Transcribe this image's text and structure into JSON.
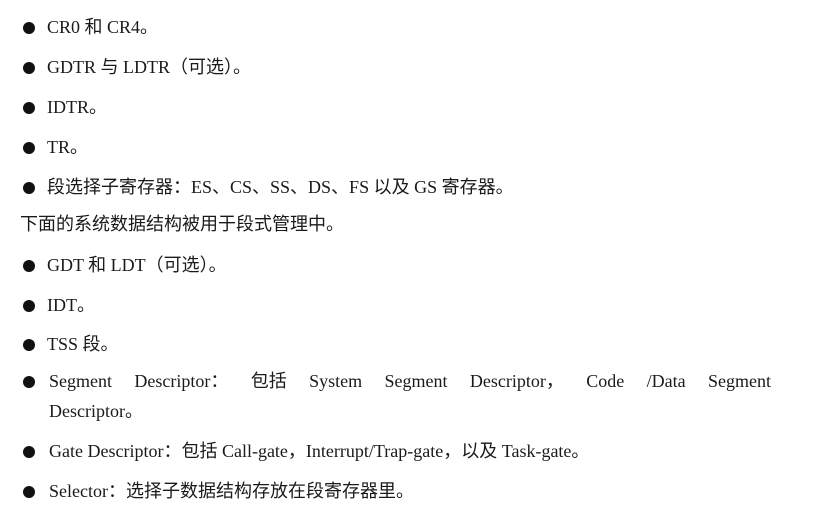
{
  "list1": [
    "CR0 和 CR4。",
    "GDTR 与 LDTR（可选）。",
    "IDTR。",
    "TR。",
    "段选择子寄存器：ES、CS、SS、DS、FS 以及 GS 寄存器。"
  ],
  "paragraph": "下面的系统数据结构被用于段式管理中。",
  "list2": [
    "GDT 和 LDT（可选）。",
    "IDT。",
    "TSS 段。"
  ],
  "segment_descriptor": {
    "line1_words": [
      "Segment",
      "Descriptor：",
      "包括",
      "System",
      "Segment",
      "Descriptor，",
      "Code",
      "/Data",
      "Segment"
    ],
    "line2": "Descriptor。"
  },
  "gate_descriptor": "Gate Descriptor：包括 Call-gate，Interrupt/Trap-gate，以及 Task-gate。",
  "selector": "Selector：选择子数据结构存放在段寄存器里。"
}
